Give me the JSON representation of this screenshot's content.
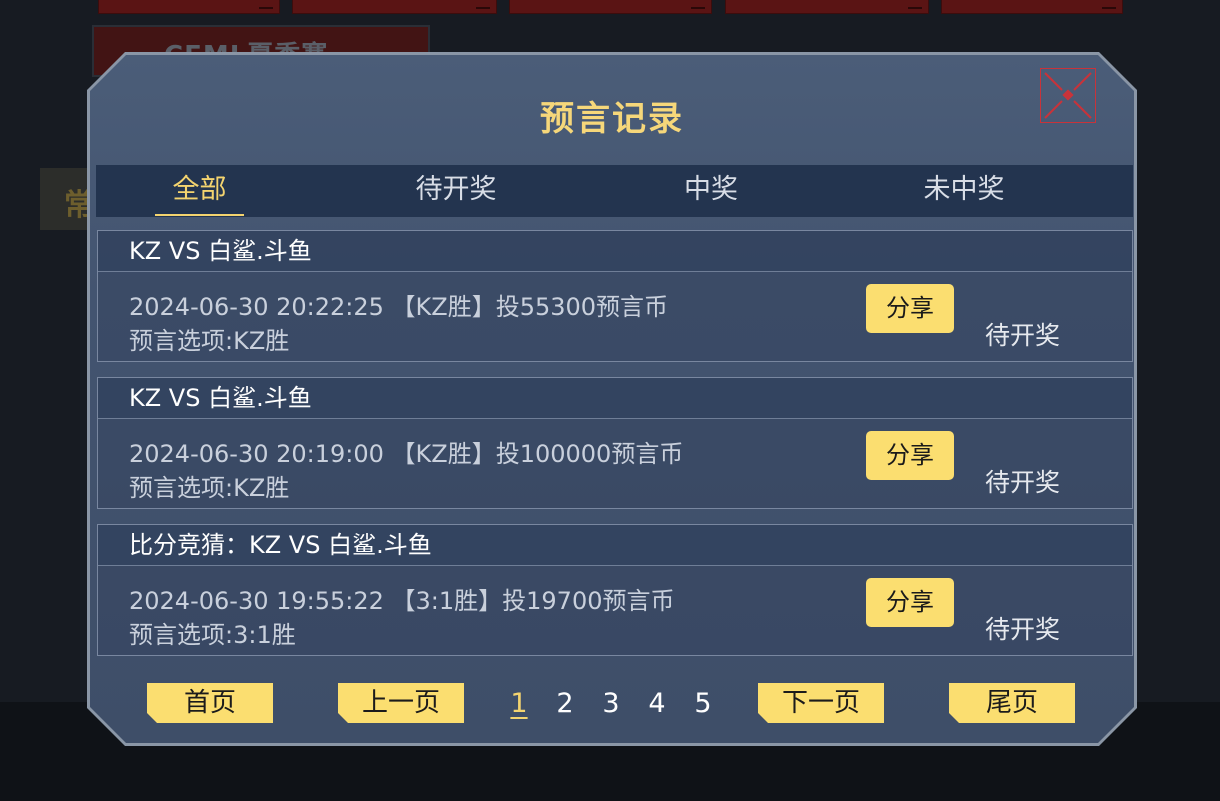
{
  "background": {
    "event_title": "CFML夏季赛",
    "side_tag": "常"
  },
  "dialog": {
    "title": "预言记录",
    "close_icon": "close-x-icon",
    "tabs": [
      {
        "label": "全部",
        "active": true
      },
      {
        "label": "待开奖",
        "active": false
      },
      {
        "label": "中奖",
        "active": false
      },
      {
        "label": "未中奖",
        "active": false
      }
    ],
    "records": [
      {
        "match": "KZ VS 白鲨.斗鱼",
        "detail": "2024-06-30 20:22:25 【KZ胜】投55300预言币",
        "option": "预言选项:KZ胜",
        "share_label": "分享",
        "status": "待开奖"
      },
      {
        "match": "KZ VS 白鲨.斗鱼",
        "detail": "2024-06-30 20:19:00 【KZ胜】投100000预言币",
        "option": "预言选项:KZ胜",
        "share_label": "分享",
        "status": "待开奖"
      },
      {
        "match": "比分竞猜：KZ VS 白鲨.斗鱼",
        "detail": "2024-06-30 19:55:22 【3:1胜】投19700预言币",
        "option": "预言选项:3:1胜",
        "share_label": "分享",
        "status": "待开奖"
      }
    ],
    "pagination": {
      "first": "首页",
      "prev": "上一页",
      "pages": [
        "1",
        "2",
        "3",
        "4",
        "5"
      ],
      "current_page": "1",
      "next": "下一页",
      "last": "尾页"
    }
  },
  "colors": {
    "accent_yellow": "#f4d46f",
    "button_yellow": "#fbde70",
    "close_red": "#c8333a",
    "panel_blue": "#435470"
  }
}
